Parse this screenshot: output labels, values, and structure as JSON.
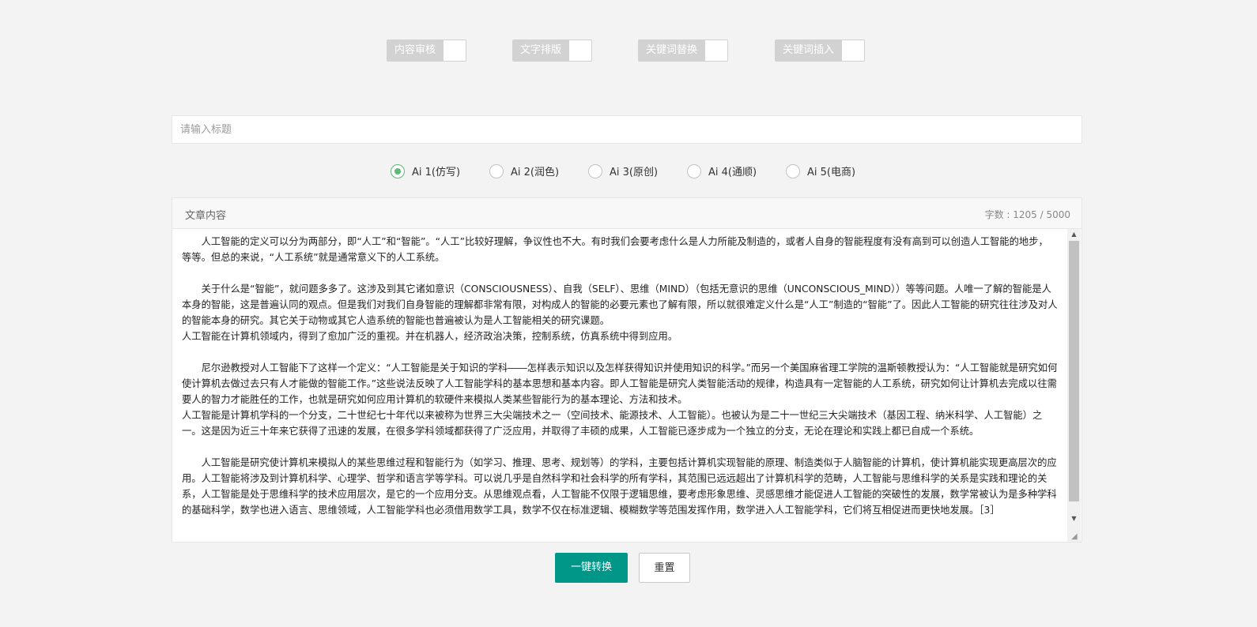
{
  "toggles": [
    {
      "label": "内容审核"
    },
    {
      "label": "文字排版"
    },
    {
      "label": "关键词替换"
    },
    {
      "label": "关键词插入"
    }
  ],
  "title_input": {
    "placeholder": "请输入标题",
    "value": ""
  },
  "radios": [
    {
      "label": "Ai 1(仿写)",
      "checked": true
    },
    {
      "label": "Ai 2(润色)",
      "checked": false
    },
    {
      "label": "Ai 3(原创)",
      "checked": false
    },
    {
      "label": "Ai 4(通顺)",
      "checked": false
    },
    {
      "label": "Ai 5(电商)",
      "checked": false
    }
  ],
  "article": {
    "header_title": "文章内容",
    "count_label": "字数 : 1205 / 5000",
    "paragraphs": [
      "　　人工智能的定义可以分为两部分，即“人工”和“智能”。“人工”比较好理解，争议性也不大。有时我们会要考虑什么是人力所能及制造的，或者人自身的智能程度有没有高到可以创造人工智能的地步，等等。但总的来说，“人工系统”就是通常意义下的人工系统。",
      "",
      "　　关于什么是“智能”，就问题多多了。这涉及到其它诸如意识（CONSCIOUSNESS）、自我（SELF）、思维（MIND）（包括无意识的思维（UNCONSCIOUS_MIND））等等问题。人唯一了解的智能是人本身的智能，这是普遍认同的观点。但是我们对我们自身智能的理解都非常有限，对构成人的智能的必要元素也了解有限，所以就很难定义什么是“人工”制造的“智能”了。因此人工智能的研究往往涉及对人的智能本身的研究。其它关于动物或其它人造系统的智能也普遍被认为是人工智能相关的研究课题。",
      "人工智能在计算机领域内，得到了愈加广泛的重视。并在机器人，经济政治决策，控制系统，仿真系统中得到应用。",
      "",
      "　　尼尔逊教授对人工智能下了这样一个定义：“人工智能是关于知识的学科――怎样表示知识以及怎样获得知识并使用知识的科学。”而另一个美国麻省理工学院的温斯顿教授认为：“人工智能就是研究如何使计算机去做过去只有人才能做的智能工作。”这些说法反映了人工智能学科的基本思想和基本内容。即人工智能是研究人类智能活动的规律，构造具有一定智能的人工系统，研究如何让计算机去完成以往需要人的智力才能胜任的工作，也就是研究如何应用计算机的软硬件来模拟人类某些智能行为的基本理论、方法和技术。",
      "人工智能是计算机学科的一个分支，二十世纪七十年代以来被称为世界三大尖端技术之一（空间技术、能源技术、人工智能）。也被认为是二十一世纪三大尖端技术（基因工程、纳米科学、人工智能）之一。这是因为近三十年来它获得了迅速的发展，在很多学科领域都获得了广泛应用，并取得了丰硕的成果，人工智能已逐步成为一个独立的分支，无论在理论和实践上都已自成一个系统。",
      "",
      "　　人工智能是研究使计算机来模拟人的某些思维过程和智能行为（如学习、推理、思考、规划等）的学科，主要包括计算机实现智能的原理、制造类似于人脑智能的计算机，使计算机能实现更高层次的应用。人工智能将涉及到计算机科学、心理学、哲学和语言学等学科。可以说几乎是自然科学和社会科学的所有学科，其范围已远远超出了计算机科学的范畴，人工智能与思维科学的关系是实践和理论的关系，人工智能是处于思维科学的技术应用层次，是它的一个应用分支。从思维观点看，人工智能不仅限于逻辑思维，要考虑形象思维、灵感思维才能促进人工智能的突破性的发展，数学常被认为是多种学科的基础科学，数学也进入语言、思维领域，人工智能学科也必须借用数学工具，数学不仅在标准逻辑、模糊数学等范围发挥作用，数学进入人工智能学科，它们将互相促进而更快地发展。［3］"
    ]
  },
  "buttons": {
    "convert": "一键转换",
    "reset": "重置"
  },
  "colors": {
    "primary": "#009688",
    "radio_checked": "#5fb878",
    "toggle_label_bg": "#d2d2d2"
  },
  "icons": {
    "scroll_up": "triangle-up-icon",
    "scroll_down": "triangle-down-icon",
    "resize": "resize-grip-icon"
  }
}
